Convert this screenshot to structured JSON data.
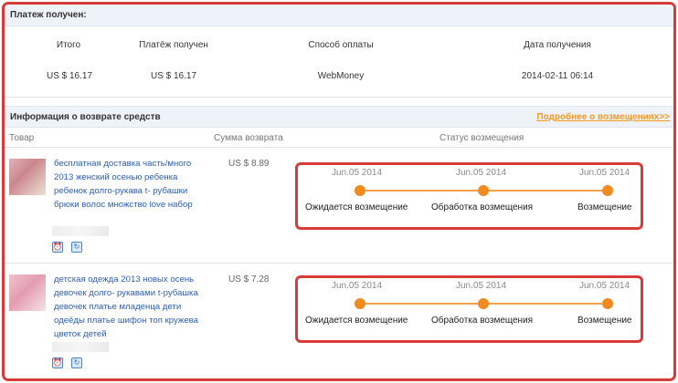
{
  "payment": {
    "section_title": "Платеж получен:",
    "headers": [
      "Итого",
      "Платёж получен",
      "Способ оплаты",
      "Дата получения"
    ],
    "values": [
      "US $ 16.17",
      "US $ 16.17",
      "WebMoney",
      "2014-02-11 06:14"
    ]
  },
  "refund": {
    "section_title": "Информация о возврате средств",
    "more_link": "Подробнее о возмещениях>>",
    "columns": [
      "Товар",
      "Сумма возврата",
      "Статус возмещения"
    ],
    "items": [
      {
        "title": "бесплатная доставка часть/много 2013 женский осенью ребенка ребенок долго-рукава t- рубашки брюки волос множство love набор",
        "amount": "US $ 8.89",
        "steps": [
          {
            "date": "Jun.05 2014",
            "label": "Ожидается возмещение"
          },
          {
            "date": "Jun.05 2014",
            "label": "Обработка возмещения"
          },
          {
            "date": "Jun.05 2014",
            "label": "Возмещение"
          }
        ]
      },
      {
        "title": "детская одежда 2013 новых осень девочек долго- рукавами t-рубашка девочек платье младенца дети одеёды платье шифон топ кружева цветок детей",
        "amount": "US $ 7.28",
        "steps": [
          {
            "date": "Jun.05 2014",
            "label": "Ожидается возмещение"
          },
          {
            "date": "Jun.05 2014",
            "label": "Обработка возмещения"
          },
          {
            "date": "Jun.05 2014",
            "label": "Возмещение"
          }
        ]
      }
    ]
  },
  "icons": {
    "alarm": "alarm-clock-icon",
    "refresh": "refresh-icon"
  },
  "colors": {
    "accent_orange": "#f08c1f",
    "link_blue": "#2b5fb0",
    "highlight_red": "#d93b3b",
    "header_bg": "#eef3fa"
  }
}
